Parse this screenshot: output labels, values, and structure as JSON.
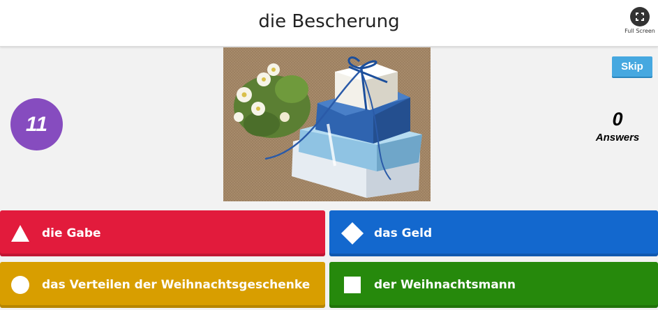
{
  "question": {
    "title": "die Bescherung"
  },
  "fullscreen": {
    "label": "Full Screen"
  },
  "timer": {
    "value": "11"
  },
  "skip": {
    "label": "Skip"
  },
  "answers_counter": {
    "count": "0",
    "label": "Answers"
  },
  "media": {
    "icon": "gift-boxes-photo"
  },
  "options": [
    {
      "shape": "triangle",
      "label": "die Gabe",
      "color": "#e21b3c"
    },
    {
      "shape": "diamond",
      "label": "das Geld",
      "color": "#1368ce"
    },
    {
      "shape": "circle",
      "label": "das Verteilen der Weihnachtsgeschenke",
      "color": "#d89e00"
    },
    {
      "shape": "square",
      "label": "der Weihnachtsmann",
      "color": "#26890c"
    }
  ]
}
